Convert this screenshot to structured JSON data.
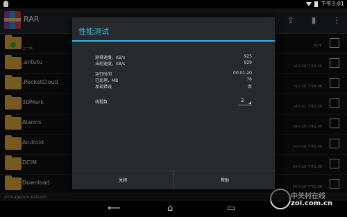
{
  "statusbar": {
    "time": "下午3:01"
  },
  "actionbar": {
    "title": "RAR",
    "icons": [
      "archive-icon",
      "extract-icon",
      "delete-icon",
      "overflow-menu-icon"
    ]
  },
  "list": {
    "up": {
      "label": "上一级",
      "meta": "SD卡"
    },
    "rows": [
      {
        "name": ".antutu",
        "meta": "14-7-29 下午4:06"
      },
      {
        "name": ".PocketCloud",
        "meta": "14-7-30 下午4:08"
      },
      {
        "name": "3DMark",
        "meta": "14-7-31 下午2:50"
      },
      {
        "name": "Alarms",
        "meta": "14-7-29 下午2:09"
      },
      {
        "name": "Android",
        "meta": "14-7-29 下午2:09"
      },
      {
        "name": "DCIM",
        "meta": "14-7-29 下午2:09"
      },
      {
        "name": "Download",
        "meta": "14-7-29 下午2:09"
      }
    ]
  },
  "pathbar": {
    "path": "/storage/emulated/0"
  },
  "watermark": {
    "cn": "中关村在线",
    "en": "zol.com.cn"
  },
  "dialog": {
    "title": "性能测试",
    "stats": [
      {
        "label": "测得速度，KB/s",
        "value": "925"
      },
      {
        "label": "当前速度，KB/s",
        "value": "929"
      },
      {
        "label": "运行时间",
        "value": "00:01:20"
      },
      {
        "label": "已处理，MB",
        "value": "76"
      },
      {
        "label": "发现错误",
        "value": "否"
      }
    ],
    "threads_label": "线程数",
    "threads_value": "2",
    "close_label": "关闭",
    "help_label": "帮助"
  }
}
